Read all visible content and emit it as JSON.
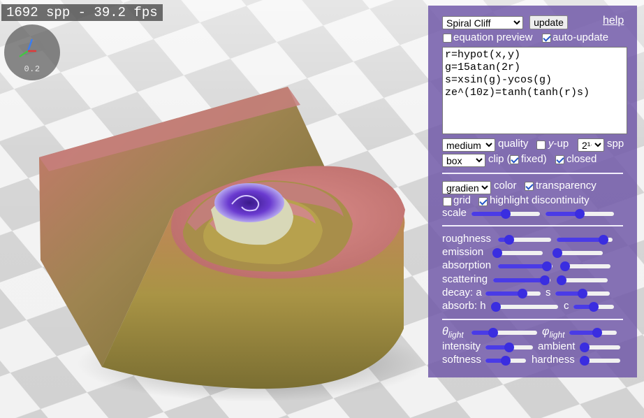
{
  "viewport": {
    "fps_text": "1692 spp - 39.2 fps",
    "axes_scale": "0.2"
  },
  "panel": {
    "preset": {
      "selected": "Spiral Cliff"
    },
    "update_label": "update",
    "help_label": "help",
    "equation_preview": {
      "label": "equation preview",
      "checked": false
    },
    "auto_update": {
      "label": "auto-update",
      "checked": true
    },
    "equation_text": "r=hypot(x,y)\ng=15atan(2r)\ns=xsin(g)-ycos(g)\nze^(10z)=tanh(tanh(r)s)",
    "quality": {
      "selected": "medium",
      "label": "quality"
    },
    "y_up": {
      "label_y": "y",
      "label_rest": "-up",
      "checked": false
    },
    "spp": {
      "selected": "2¹⁴",
      "label": "spp"
    },
    "clip": {
      "selected": "box",
      "label": "clip (",
      "fixed_label": "fixed)",
      "fixed_checked": true
    },
    "closed": {
      "label": "closed",
      "checked": true
    },
    "color": {
      "selected": "gradient",
      "label": "color"
    },
    "transparency": {
      "label": "transparency",
      "checked": true
    },
    "grid": {
      "label": "grid",
      "checked": false
    },
    "highlight_discontinuity": {
      "label": "highlight discontinuity",
      "checked": true
    },
    "scale": {
      "label": "scale",
      "value_1": 0.5,
      "value_2": 0.5
    },
    "roughness": {
      "label": "roughness",
      "value_1": 0.15,
      "value_2": 0.91
    },
    "emission": {
      "label": "emission",
      "value_1": 0.0,
      "value_2": 0.0
    },
    "absorption": {
      "label": "absorption",
      "value_1": 0.99,
      "value_2": 0.0
    },
    "scattering": {
      "label": "scattering",
      "value_1": 0.99,
      "value_2": 0.0
    },
    "decay_a": {
      "label": "decay: a",
      "value": 0.7
    },
    "decay_s": {
      "label": "s",
      "value": 0.5
    },
    "absorb_h": {
      "label": "absorb: h",
      "value": 0.0
    },
    "absorb_c": {
      "label": "c",
      "value": 0.5
    },
    "theta_light": {
      "symbol": "θ",
      "sub": "light",
      "value": 0.3
    },
    "phi_light": {
      "symbol": "φ",
      "sub": "light",
      "value": 0.62
    },
    "intensity": {
      "label": "intensity",
      "value": 0.5
    },
    "ambient": {
      "label": "ambient",
      "value": 0.0
    },
    "softness": {
      "label": "softness",
      "value": 0.5
    },
    "hardness": {
      "label": "hardness",
      "value": 0.0
    }
  }
}
